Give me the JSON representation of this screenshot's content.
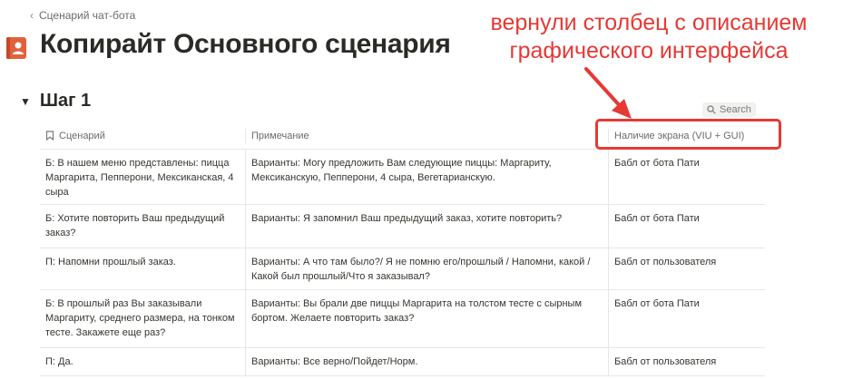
{
  "breadcrumb": {
    "label": "Сценарий чат-бота"
  },
  "page": {
    "title": "Копирайт Основного сценария"
  },
  "annotation": {
    "line1": "вернули столбец с описанием",
    "line2": "графического интерфейса",
    "color": "#e53935"
  },
  "section": {
    "title": "Шаг 1"
  },
  "search": {
    "label": "Search"
  },
  "table": {
    "headers": [
      "Сценарий",
      "Примечание",
      "Наличие экрана (VIU + GUI)"
    ],
    "rows": [
      [
        "Б: В нашем меню представлены: пицца Маргарита, Пепперони, Мексиканская, 4 сыра",
        "Варианты: Могу предложить Вам следующие пиццы: Маргариту, Мексиканскую, Пепперони, 4 сыра, Вегетарианскую.",
        "Бабл от бота Пати"
      ],
      [
        "Б: Хотите повторить Ваш предыдущий заказ?",
        "Варианты: Я запомнил Ваш предыдущий заказ, хотите повторить?",
        "Бабл от бота Пати"
      ],
      [
        "П: Напомни прошлый заказ.",
        "Варианты: А что там было?/ Я не помню его/прошлый /  Напомни, какой /  Какой был прошлый/Что я заказывал?",
        "Бабл от пользователя"
      ],
      [
        "Б: В прошлый раз Вы заказывали Маргариту, среднего размера, на тонком тесте. Закажете еще раз?",
        "Варианты: Вы брали две пиццы Маргарита на толстом тесте с сырным бортом. Желаете повторить заказ?",
        "Бабл от бота Пати"
      ],
      [
        "П: Да.",
        "Варианты: Все верно/Пойдет/Норм.",
        "Бабл от пользователя"
      ]
    ]
  }
}
